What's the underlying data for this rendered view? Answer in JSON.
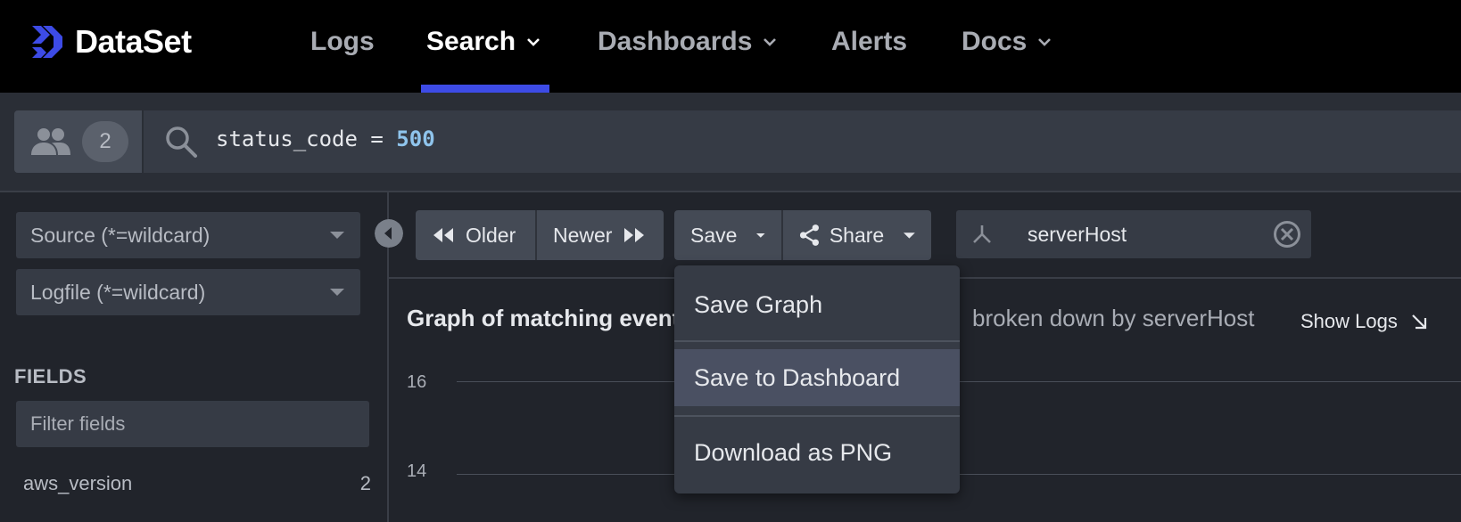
{
  "app": {
    "name": "DataSet",
    "brand_color": "#3d4be6"
  },
  "nav": {
    "items": [
      {
        "label": "Logs",
        "has_chevron": false
      },
      {
        "label": "Search",
        "has_chevron": true,
        "active": true
      },
      {
        "label": "Dashboards",
        "has_chevron": true
      },
      {
        "label": "Alerts",
        "has_chevron": false
      },
      {
        "label": "Docs",
        "has_chevron": true
      }
    ]
  },
  "query": {
    "viewer_count": "2",
    "text_prefix": "status_code = ",
    "text_value": "500"
  },
  "sidebar": {
    "source_placeholder": "Source (*=wildcard)",
    "logfile_placeholder": "Logfile (*=wildcard)",
    "fields_heading": "FIELDS",
    "filter_placeholder": "Filter fields",
    "fields": [
      {
        "name": "aws_version",
        "count": "2"
      }
    ]
  },
  "toolbar": {
    "older_label": "Older",
    "newer_label": "Newer",
    "save_label": "Save",
    "share_label": "Share",
    "breakdown_field": "serverHost"
  },
  "save_menu": {
    "items": [
      {
        "label": "Save Graph"
      },
      {
        "label": "Save to Dashboard",
        "highlighted": true
      },
      {
        "label": "Download as PNG"
      }
    ]
  },
  "graph": {
    "title": "Graph of matching events",
    "subtitle": "broken down by serverHost",
    "show_logs_label": "Show Logs",
    "y_ticks": [
      "16",
      "14"
    ]
  }
}
